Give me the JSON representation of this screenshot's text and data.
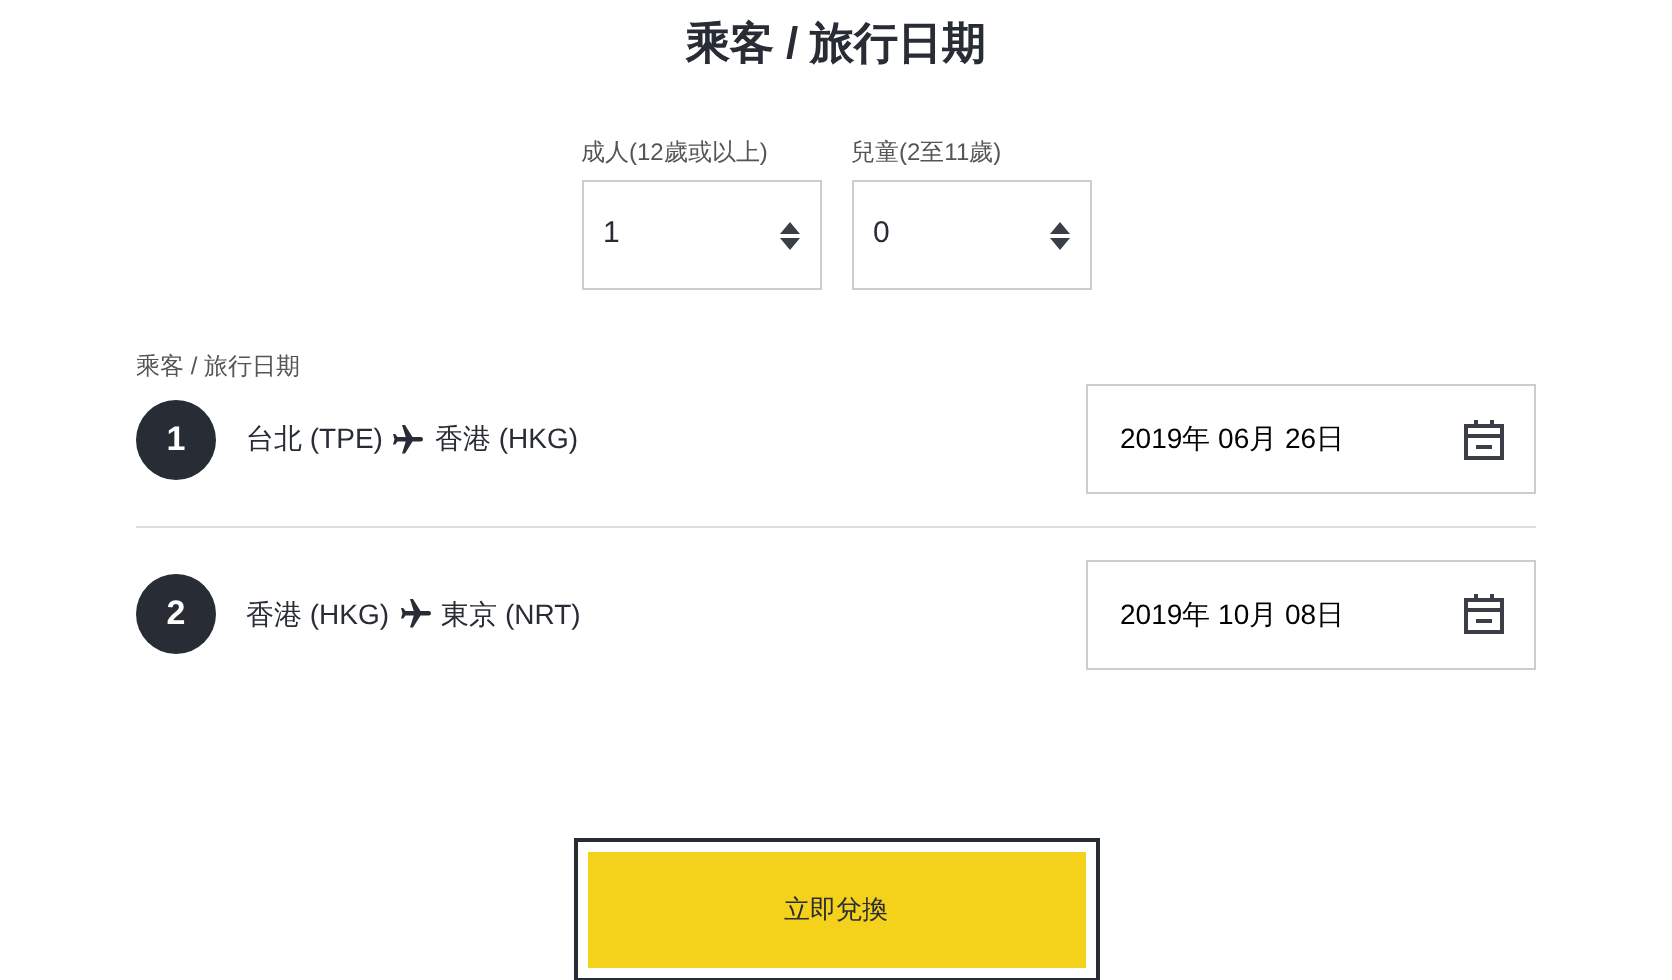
{
  "title": "乘客 / 旅行日期",
  "passengers": [
    {
      "label": "成人(12歲或以上)",
      "value": "1"
    },
    {
      "label": "兒童(2至11歲)",
      "value": "0"
    }
  ],
  "section_label": "乘客 / 旅行日期",
  "trips": [
    {
      "number": "1",
      "from": "台北 (TPE)",
      "to": "香港 (HKG)",
      "date": "2019年 06月 26日"
    },
    {
      "number": "2",
      "from": "香港 (HKG)",
      "to": "東京 (NRT)",
      "date": "2019年 10月 08日"
    }
  ],
  "submit_button": "立即兌換"
}
